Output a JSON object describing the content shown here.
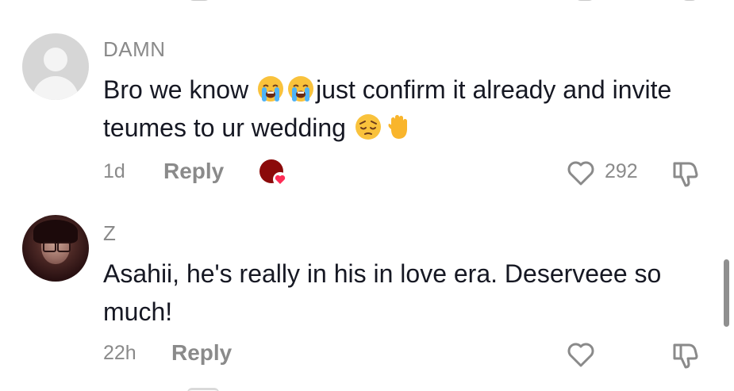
{
  "comments": [
    {
      "username": "DAMN",
      "text_part1": "Bro we know",
      "text_part2": "just confirm it already and invite teumes to ur wedding",
      "emojis_inline": [
        "loudly-crying-face-emoji",
        "loudly-crying-face-emoji"
      ],
      "emojis_end": [
        "pensive-face-emoji",
        "raised-hand-emoji"
      ],
      "time": "1d",
      "reply_label": "Reply",
      "liked_by_creator": true,
      "like_count": "292"
    },
    {
      "username": "Z",
      "text": "Asahii, he's really in his in love era. Deserveee so much!",
      "time": "22h",
      "reply_label": "Reply",
      "liked_by_creator": false,
      "like_count": ""
    }
  ],
  "colors": {
    "text": "#161823",
    "meta": "#8a8a8a",
    "creator_badge": "#8b0a0a",
    "heart_badge": "#fe2c55"
  }
}
